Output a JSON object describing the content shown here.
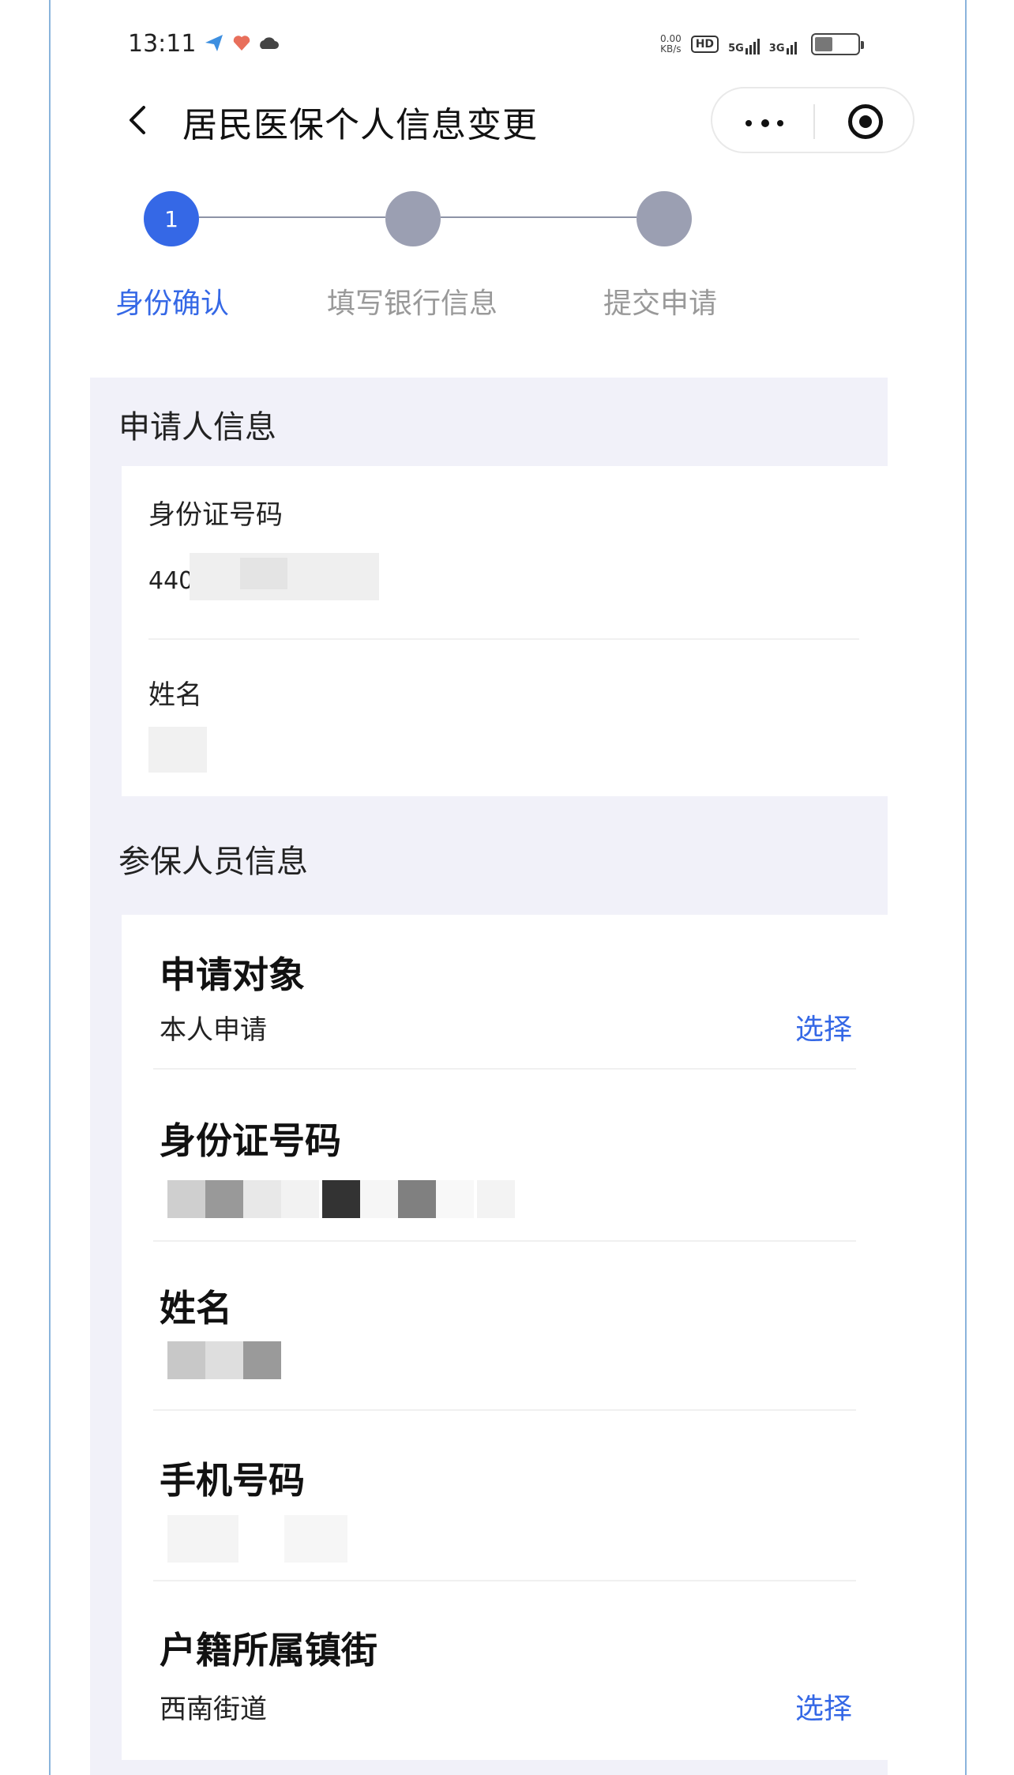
{
  "status_bar": {
    "time": "13:11",
    "net_speed": "0.00",
    "net_unit": "KB/s",
    "hd": "HD",
    "sig1": "5G",
    "sig2": "3G"
  },
  "nav": {
    "title": "居民医保个人信息变更"
  },
  "stepper": {
    "steps": [
      {
        "num": "1",
        "label": "身份确认",
        "active": true
      },
      {
        "num": "",
        "label": "填写银行信息",
        "active": false
      },
      {
        "num": "",
        "label": "提交申请",
        "active": false
      }
    ],
    "active_color": "#3568e6",
    "inactive_color": "#9b9fb2"
  },
  "applicant": {
    "section_title": "申请人信息",
    "id_label": "身份证号码",
    "id_value_prefix": "440",
    "name_label": "姓名"
  },
  "insured": {
    "section_title": "参保人员信息",
    "applicant_target": {
      "label": "申请对象",
      "value": "本人申请",
      "action": "选择"
    },
    "id": {
      "label": "身份证号码"
    },
    "name": {
      "label": "姓名"
    },
    "phone": {
      "label": "手机号码"
    },
    "street": {
      "label": "户籍所属镇街",
      "value": "西南街道",
      "action": "选择"
    }
  }
}
